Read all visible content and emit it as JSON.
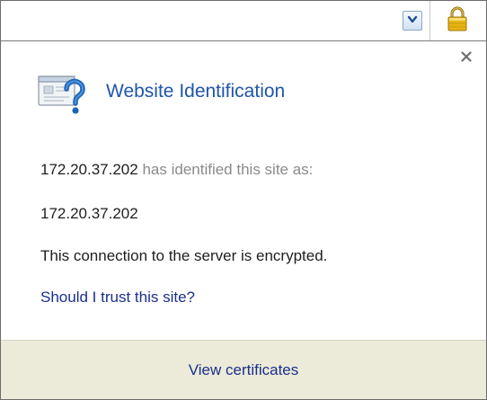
{
  "address_bar": {
    "dropdown_icon": "chevron-down-icon",
    "lock_icon": "padlock-icon"
  },
  "popup": {
    "close_icon": "close-icon",
    "header_icon": "website-question-icon",
    "title": "Website Identification",
    "identified_host": "172.20.37.202",
    "identified_suffix": "has identified this site as:",
    "identity": "172.20.37.202",
    "encryption_status": "This connection to the server is encrypted.",
    "trust_link": "Should I trust this site?",
    "view_certificates": "View certificates"
  },
  "colors": {
    "title": "#1f55a8",
    "link": "#1a2f8c",
    "muted_text": "#8a8a8a",
    "footer_bg": "#ecead9",
    "lock_gold": "#e8b412"
  }
}
